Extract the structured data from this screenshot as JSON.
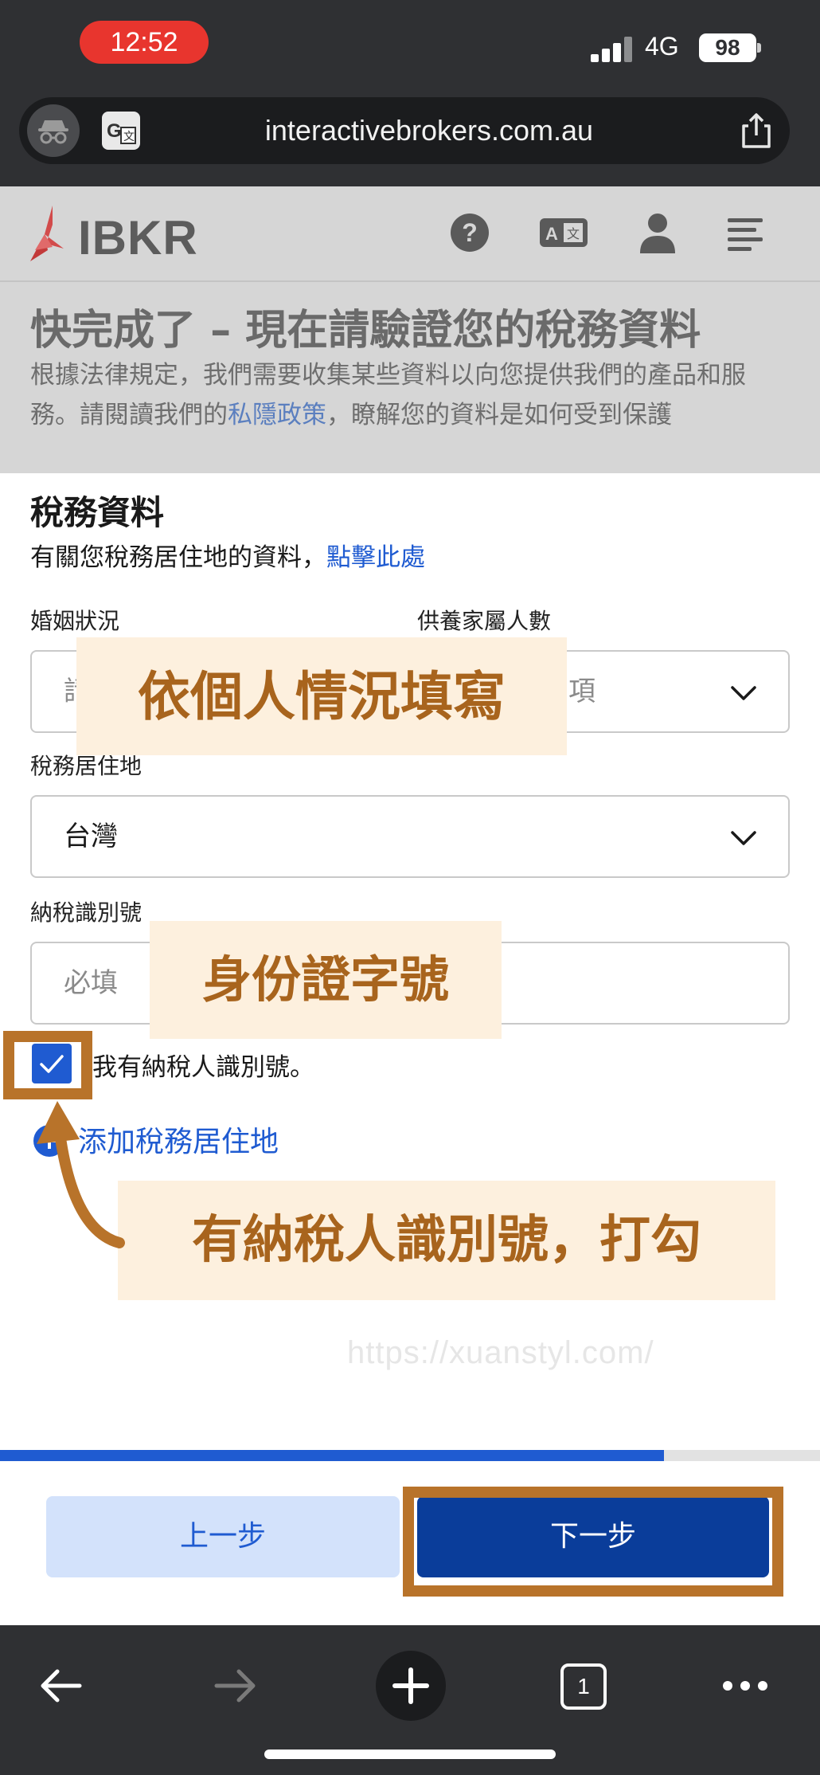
{
  "status_bar": {
    "time": "12:52",
    "network": "4G",
    "battery": "98"
  },
  "browser": {
    "url": "interactivebrokers.com.au",
    "tab_count": "1"
  },
  "site": {
    "logo_text": "IBKR",
    "header_icons": [
      "help-icon",
      "language-icon",
      "account-icon",
      "menu-icon"
    ]
  },
  "intro": {
    "title": "快完成了 – 現在請驗證您的稅務資料",
    "text_before": "根據法律規定，我們需要收集某些資料以向您提供我們的產品和服務。請閱讀我們的",
    "privacy_link": "私隱政策",
    "text_after": "，瞭解您的資料是如何受到保護"
  },
  "form": {
    "section_title": "稅務資料",
    "section_sub": "有關您稅務居住地的資料，",
    "section_link": "點擊此處",
    "marital_label": "婚姻狀況",
    "marital_placeholder": "請",
    "dependents_label": "供養家屬人數",
    "dependents_placeholder": "項",
    "residence_label": "稅務居住地",
    "residence_value": "台灣",
    "tin_label": "納稅識別號",
    "tin_placeholder": "必填",
    "has_tin_label": "我有納稅人識別號。",
    "has_tin_checked": true,
    "add_residence": "添加稅務居住地"
  },
  "progress": {
    "value": 0.81
  },
  "footer": {
    "back_label": "上一步",
    "next_label": "下一步"
  },
  "watermark": "https://xuanstyl.com/",
  "annotations": {
    "fill_note": "依個人情況填寫",
    "id_note": "身份證字號",
    "check_note": "有納稅人識別號，打勾",
    "color": "#b8732a"
  },
  "colors": {
    "primary": "#1f5bd1",
    "primary_dark": "#0a3d9a",
    "secondary_bg": "#d3e2fb",
    "status_pill": "#e8352e"
  }
}
